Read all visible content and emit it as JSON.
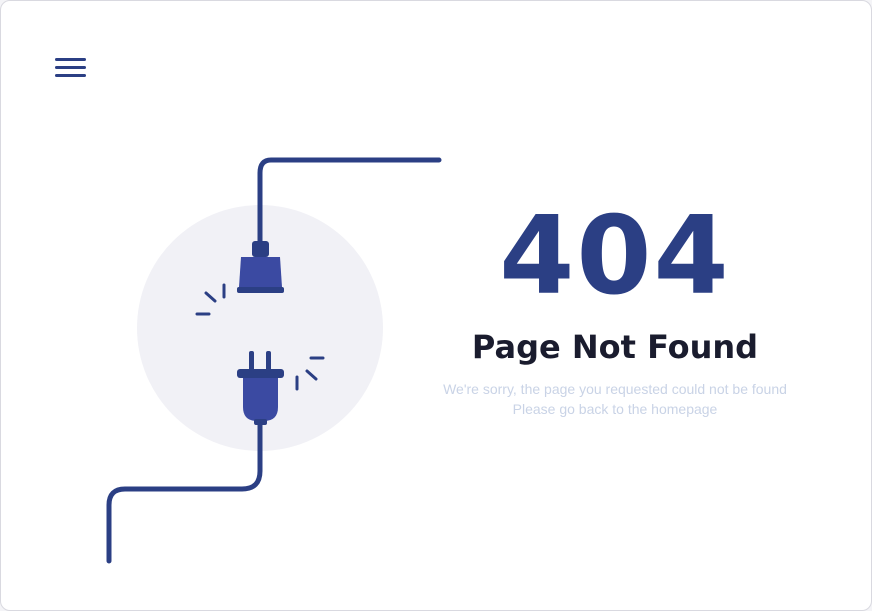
{
  "menu": {
    "icon": "hamburger-menu-icon"
  },
  "illustration": {
    "icons": [
      "power-cord-icon",
      "socket-icon",
      "plug-icon",
      "spark-icon"
    ],
    "colors": {
      "cable": "#2b3f84",
      "plug": "#3b4aa2",
      "circle": "#f1f1f6",
      "spark": "#2b3f84"
    }
  },
  "error": {
    "code": "404",
    "title": "Page Not Found",
    "message_line1": "We're sorry, the page you requested could not be found",
    "message_line2": "Please go back to the homepage"
  },
  "colors": {
    "accent": "#2b3f84",
    "title": "#1a1c2e",
    "message": "#c9d3e6",
    "background": "#ffffff"
  }
}
